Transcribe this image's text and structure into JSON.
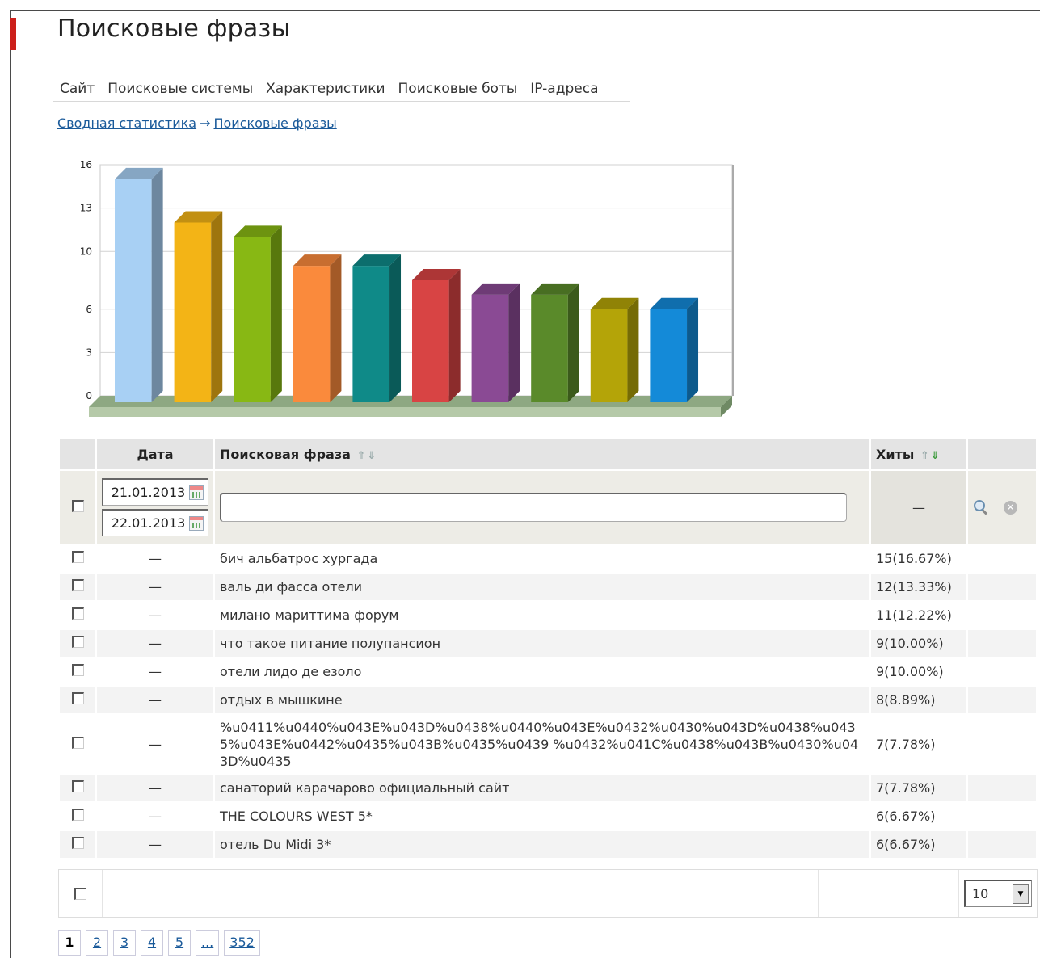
{
  "title": "Поисковые фразы",
  "tabs": [
    "Сайт",
    "Поисковые системы",
    "Характеристики",
    "Поисковые боты",
    "IP-адреса"
  ],
  "breadcrumb": {
    "items": [
      "Сводная статистика",
      "Поисковые фразы"
    ],
    "separator": "→"
  },
  "chart_data": {
    "type": "bar",
    "categories": [
      "",
      "",
      "",
      "",
      "",
      "",
      "",
      "",
      "",
      ""
    ],
    "values": [
      15,
      12,
      11,
      9,
      9,
      8,
      7,
      7,
      6,
      6
    ],
    "colors": [
      "#a8d0f4",
      "#f3b416",
      "#88b814",
      "#fa8a3c",
      "#0f8a88",
      "#d84444",
      "#8a4a94",
      "#5a8a2a",
      "#b4a408",
      "#148ad8"
    ],
    "yticks": [
      "0",
      "3",
      "6",
      "10",
      "13",
      "16"
    ],
    "ylim": [
      0,
      16
    ],
    "grid": true,
    "title": "",
    "xlabel": "",
    "ylabel": ""
  },
  "table": {
    "headers": {
      "date": "Дата",
      "phrase": "Поисковая фраза",
      "hits": "Хиты",
      "sort_up": "⇑",
      "sort_down": "⇓"
    },
    "filter": {
      "date_from": "21.01.2013",
      "date_to": "22.01.2013",
      "phrase_value": "",
      "hits_placeholder": "—"
    },
    "rows": [
      {
        "date": "—",
        "phrase": "бич альбатрос хургада",
        "hits": "15(16.67%)"
      },
      {
        "date": "—",
        "phrase": "валь ди фасса отели",
        "hits": "12(13.33%)"
      },
      {
        "date": "—",
        "phrase": "милано мариттима форум",
        "hits": "11(12.22%)"
      },
      {
        "date": "—",
        "phrase": "что такое питание полупансион",
        "hits": "9(10.00%)"
      },
      {
        "date": "—",
        "phrase": "отели лидо де езоло",
        "hits": "9(10.00%)"
      },
      {
        "date": "—",
        "phrase": "отдых в мышкине",
        "hits": "8(8.89%)"
      },
      {
        "date": "—",
        "phrase": "%u0411%u0440%u043E%u043D%u0438%u0440%u043E%u0432%u0430%u043D%u0438%u0435%u043E%u0442%u0435%u043B%u0435%u0439 %u0432%u041C%u0438%u043B%u0430%u043D%u0435",
        "hits": "7(7.78%)"
      },
      {
        "date": "—",
        "phrase": "санаторий карачарово официальный сайт",
        "hits": "7(7.78%)"
      },
      {
        "date": "—",
        "phrase": "THE COLOURS WEST 5*",
        "hits": "6(6.67%)"
      },
      {
        "date": "—",
        "phrase": "отель Du Midi 3*",
        "hits": "6(6.67%)"
      }
    ]
  },
  "footer": {
    "per_page": "10"
  },
  "pager": {
    "pages": [
      "1",
      "2",
      "3",
      "4",
      "5",
      "...",
      "352"
    ],
    "current": "1"
  }
}
